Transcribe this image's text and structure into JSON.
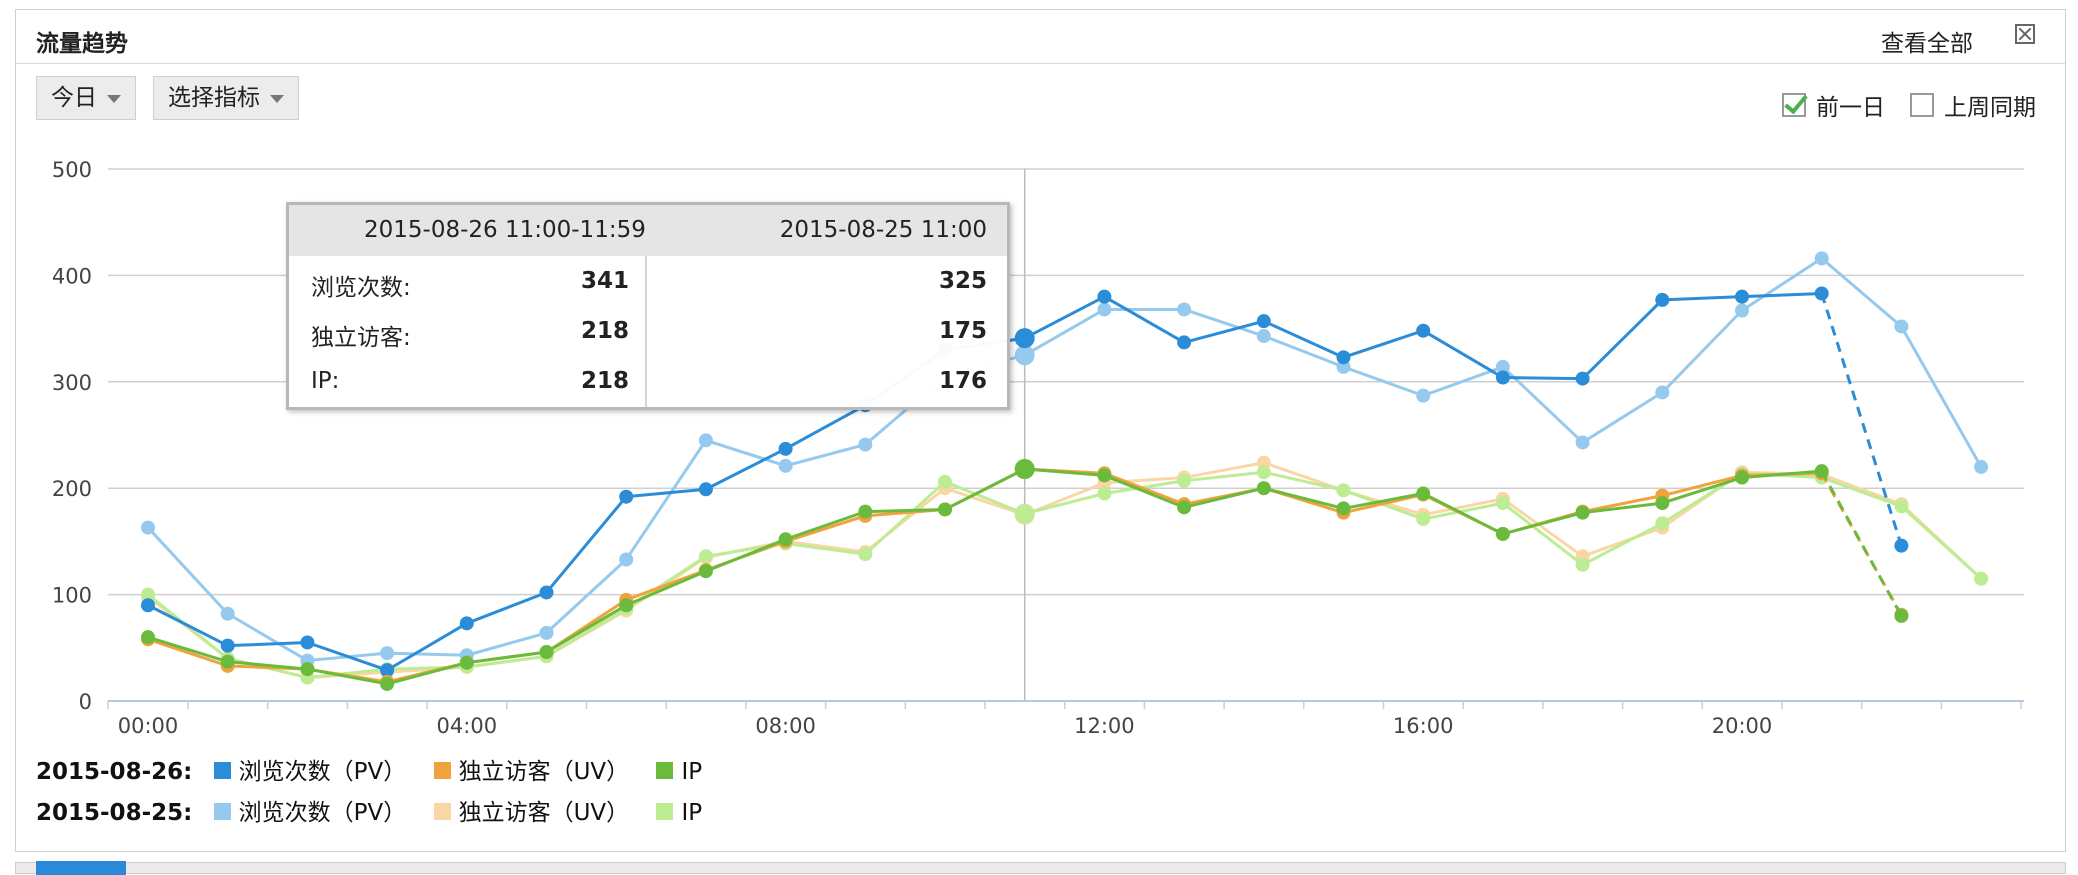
{
  "header": {
    "title": "流量趋势",
    "view_all": "查看全部"
  },
  "controls": {
    "period_dropdown": "今日",
    "metric_dropdown": "选择指标",
    "compare_prev_day": {
      "label": "前一日",
      "checked": true
    },
    "compare_last_week": {
      "label": "上周同期",
      "checked": false
    }
  },
  "tooltip": {
    "header_current": "2015-08-26 11:00-11:59",
    "header_compare": "2015-08-25 11:00",
    "rows": [
      {
        "label": "浏览次数:",
        "current": "341",
        "compare": "325"
      },
      {
        "label": "独立访客:",
        "current": "218",
        "compare": "175"
      },
      {
        "label": "IP:",
        "current": "218",
        "compare": "176"
      }
    ]
  },
  "legend": [
    {
      "date": "2015-08-26:",
      "items": [
        {
          "label": "浏览次数（PV）",
          "color": "#2b8cd8"
        },
        {
          "label": "独立访客（UV）",
          "color": "#f0a33c"
        },
        {
          "label": "IP",
          "color": "#6abb3d"
        }
      ]
    },
    {
      "date": "2015-08-25:",
      "items": [
        {
          "label": "浏览次数（PV）",
          "color": "#95c9ee"
        },
        {
          "label": "独立访客（UV）",
          "color": "#f9d6a4"
        },
        {
          "label": "IP",
          "color": "#bdec93"
        }
      ]
    }
  ],
  "chart_data": {
    "type": "line",
    "x": [
      "00:00",
      "01:00",
      "02:00",
      "03:00",
      "04:00",
      "05:00",
      "06:00",
      "07:00",
      "08:00",
      "09:00",
      "10:00",
      "11:00",
      "12:00",
      "13:00",
      "14:00",
      "15:00",
      "16:00",
      "17:00",
      "18:00",
      "19:00",
      "20:00",
      "21:00",
      "22:00",
      "23:00"
    ],
    "x_tick_labels": [
      "00:00",
      "04:00",
      "08:00",
      "12:00",
      "16:00",
      "20:00"
    ],
    "y_ticks": [
      0,
      100,
      200,
      300,
      400,
      500
    ],
    "ylim": [
      0,
      500
    ],
    "grid": true,
    "hover_x": "11:00",
    "series": [
      {
        "name": "浏览次数（PV）",
        "date": "2015-08-26",
        "color": "#2b8cd8",
        "values": [
          90,
          52,
          55,
          29,
          73,
          102,
          192,
          199,
          237,
          278,
          330,
          341,
          380,
          337,
          357,
          323,
          348,
          304,
          303,
          377,
          380,
          383,
          146,
          null
        ],
        "dashed_last_segment": true
      },
      {
        "name": "独立访客（UV）",
        "date": "2015-08-26",
        "color": "#f0a33c",
        "values": [
          58,
          33,
          30,
          18,
          36,
          46,
          95,
          123,
          150,
          174,
          180,
          218,
          214,
          185,
          200,
          177,
          194,
          157,
          178,
          193,
          212,
          214,
          81,
          null
        ],
        "dashed_last_segment": true
      },
      {
        "name": "IP",
        "date": "2015-08-26",
        "color": "#6abb3d",
        "values": [
          60,
          37,
          30,
          16,
          36,
          46,
          90,
          122,
          152,
          178,
          180,
          218,
          212,
          182,
          200,
          181,
          195,
          157,
          177,
          186,
          210,
          216,
          80,
          null
        ],
        "dashed_last_segment": true
      },
      {
        "name": "浏览次数（PV）",
        "date": "2015-08-25",
        "color": "#95c9ee",
        "values": [
          163,
          82,
          38,
          45,
          43,
          64,
          133,
          245,
          221,
          241,
          305,
          325,
          368,
          368,
          343,
          314,
          287,
          314,
          243,
          290,
          367,
          416,
          352,
          220
        ]
      },
      {
        "name": "独立访客（UV）",
        "date": "2015-08-25",
        "color": "#f9d6a4",
        "values": [
          98,
          40,
          22,
          27,
          32,
          42,
          85,
          135,
          150,
          140,
          200,
          175,
          205,
          210,
          224,
          198,
          175,
          190,
          136,
          163,
          215,
          213,
          185,
          115
        ]
      },
      {
        "name": "IP",
        "date": "2015-08-25",
        "color": "#bdec93",
        "values": [
          100,
          40,
          22,
          30,
          32,
          42,
          87,
          136,
          148,
          138,
          206,
          176,
          195,
          207,
          215,
          198,
          171,
          186,
          128,
          167,
          214,
          210,
          183,
          115
        ]
      }
    ]
  }
}
